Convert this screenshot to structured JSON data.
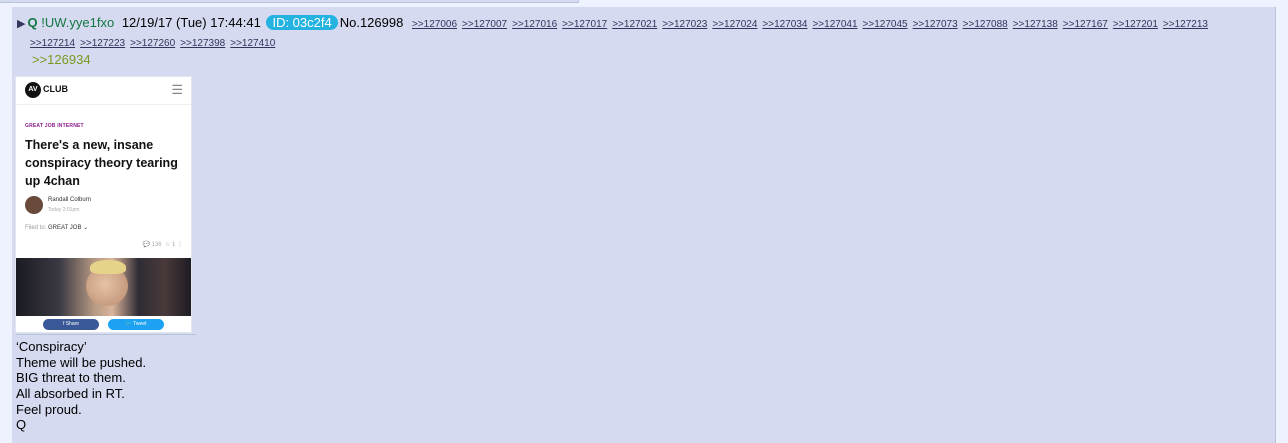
{
  "post": {
    "arrow_icon": "right-triangle-icon",
    "name": "Q",
    "tripcode": "!UW.yye1fxo",
    "datetime": "12/19/17 (Tue) 17:44:41",
    "id_badge": "ID: 03c2f4",
    "post_number": "No.126998",
    "id_badge_color": "#24b3e0",
    "backlinks": [
      ">>127006",
      ">>127007",
      ">>127016",
      ">>127017",
      ">>127021",
      ">>127023",
      ">>127024",
      ">>127034",
      ">>127041",
      ">>127045",
      ">>127073",
      ">>127088",
      ">>127138",
      ">>127167",
      ">>127201",
      ">>127213"
    ],
    "backlinks_row2": [
      ">>127214",
      ">>127223",
      ">>127260",
      ">>127398",
      ">>127410"
    ],
    "quote_link": ">>126934",
    "message_lines": [
      "‘Conspiracy’",
      "Theme will be pushed.",
      "BIG threat to them.",
      "All absorbed in RT.",
      "Feel proud.",
      "Q"
    ]
  },
  "attachment": {
    "logo_text": "AV",
    "brand": "CLUB",
    "menu_icon": "hamburger-menu-icon",
    "tag": "GREAT JOB INTERNET",
    "headline": "There's a new, insane conspiracy theory tearing up 4chan",
    "author": "Randall Colburn",
    "time": "Today 2:01pm",
    "filed_label": "Filed to:",
    "filed_value": "GREAT JOB ⌄",
    "comments": "💬 136",
    "stars": "☆ 1",
    "share_label": "f   Share",
    "tweet_label": "🐦  Tweet"
  }
}
